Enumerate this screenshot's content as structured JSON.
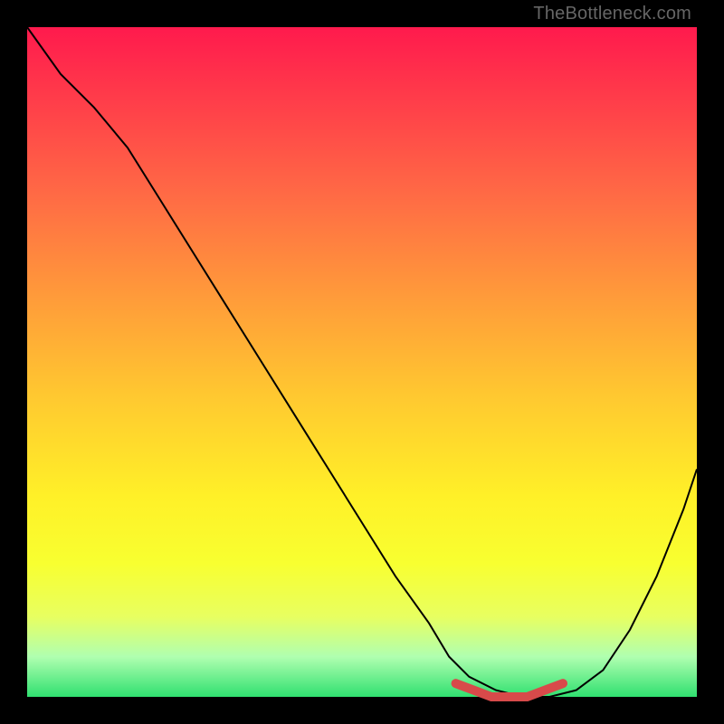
{
  "watermark": "TheBottleneck.com",
  "chart_data": {
    "type": "line",
    "title": "",
    "xlabel": "",
    "ylabel": "",
    "xlim": [
      0,
      100
    ],
    "ylim": [
      0,
      100
    ],
    "series": [
      {
        "name": "curve",
        "x": [
          0,
          5,
          10,
          15,
          20,
          25,
          30,
          35,
          40,
          45,
          50,
          55,
          60,
          63,
          66,
          70,
          74,
          78,
          82,
          86,
          90,
          94,
          98,
          100
        ],
        "values": [
          100,
          93,
          88,
          82,
          74,
          66,
          58,
          50,
          42,
          34,
          26,
          18,
          11,
          6,
          3,
          1,
          0,
          0,
          1,
          4,
          10,
          18,
          28,
          34
        ]
      }
    ],
    "highlight_band": {
      "name": "bottleneck-zone",
      "x_start": 64,
      "x_end": 80,
      "values": [
        2,
        1,
        0,
        0,
        0,
        1,
        2
      ]
    },
    "colors": {
      "curve": "#000000",
      "highlight": "#d84a4a",
      "gradient_top": "#ff1a4d",
      "gradient_bottom": "#30e070"
    }
  }
}
